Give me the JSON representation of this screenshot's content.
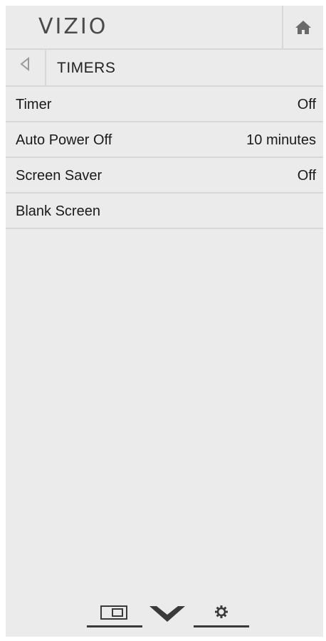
{
  "header": {
    "logo_text": "VIZIO",
    "home_icon": "home-icon"
  },
  "title_bar": {
    "back_icon": "back-arrow-icon",
    "title": "TIMERS"
  },
  "menu": [
    {
      "label": "Timer",
      "value": "Off"
    },
    {
      "label": "Auto Power Off",
      "value": "10 minutes"
    },
    {
      "label": "Screen Saver",
      "value": "Off"
    },
    {
      "label": "Blank Screen",
      "value": ""
    }
  ],
  "bottom_bar": {
    "icons": [
      "picture-in-picture-icon",
      "vizio-v-icon",
      "settings-gear-icon"
    ]
  },
  "colors": {
    "panel_bg": "#ebebeb",
    "divider": "#d7d7d7",
    "text": "#1a1a1a",
    "icon": "#3a3a3a"
  }
}
